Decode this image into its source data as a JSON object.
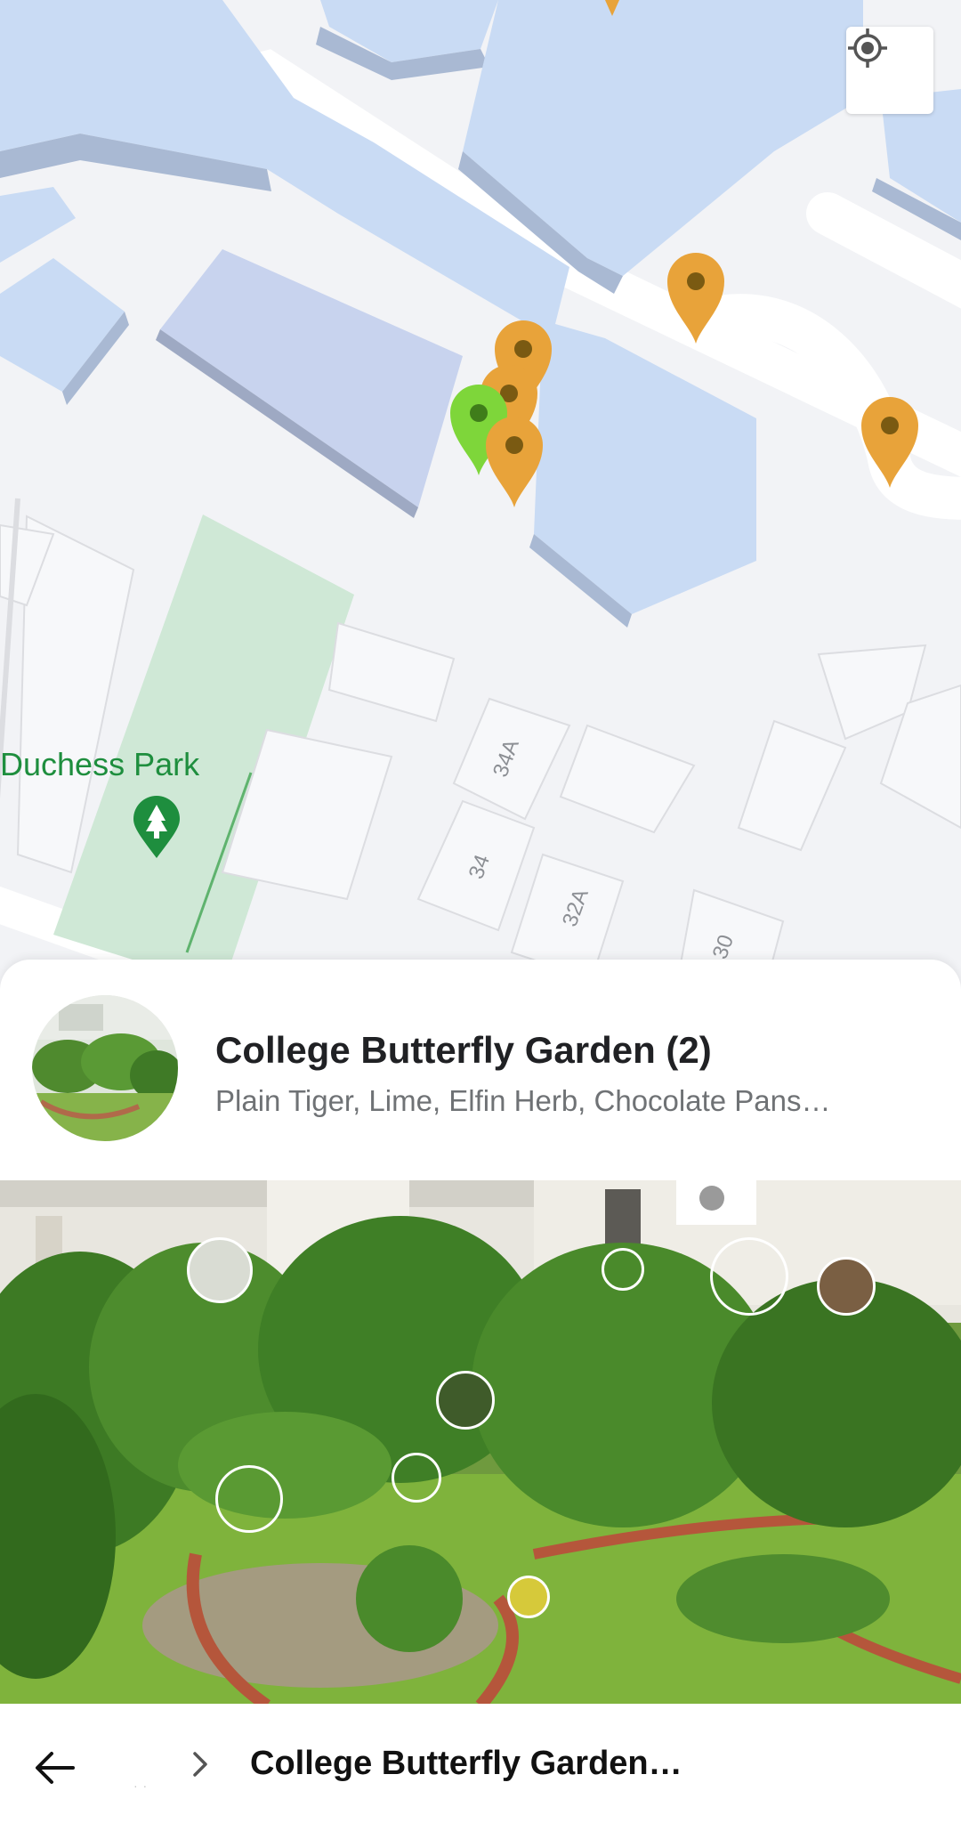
{
  "map": {
    "park_name": "Duchess Park",
    "park_icon": "tree-icon",
    "locate_button_icon": "my-location-icon",
    "address_labels": [
      "34A",
      "34",
      "32A",
      "30"
    ],
    "pin_colors": {
      "default": "#e8a33a",
      "selected": "#7ed63a",
      "pin_dot": "#7a5a12"
    }
  },
  "place": {
    "title": "College Butterfly Garden (2)",
    "subtitle": "Plain Tiger, Lime, Elfin Herb, Chocolate Pans…"
  },
  "bottom_bar": {
    "back_icon": "arrow-left-icon",
    "breadcrumb_ellipsis": "· ·",
    "chevron_icon": "chevron-right-icon",
    "title": "College Butterfly Garden…"
  }
}
